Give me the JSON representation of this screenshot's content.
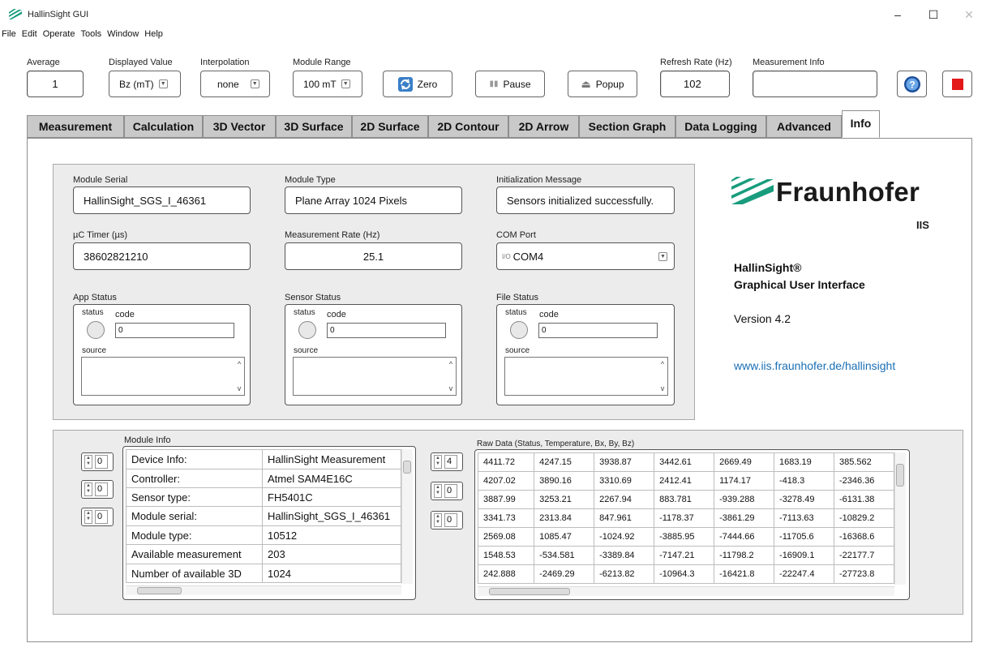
{
  "window": {
    "title": "HallinSight GUI",
    "controls": [
      "–",
      "☐",
      "✕"
    ]
  },
  "menu": [
    "File",
    "Edit",
    "Operate",
    "Tools",
    "Window",
    "Help"
  ],
  "toolbar": {
    "average": {
      "label": "Average",
      "value": "1"
    },
    "displayed_value": {
      "label": "Displayed Value",
      "value": "Bz (mT)"
    },
    "interpolation": {
      "label": "Interpolation",
      "value": "none"
    },
    "module_range": {
      "label": "Module Range",
      "value": "100 mT"
    },
    "zero_label": "Zero",
    "pause_label": "Pause",
    "popup_label": "Popup",
    "refresh_rate": {
      "label": "Refresh Rate (Hz)",
      "value": "102"
    },
    "measurement_info": {
      "label": "Measurement Info",
      "value": ""
    }
  },
  "tabs": [
    {
      "label": "Measurement"
    },
    {
      "label": "Calculation"
    },
    {
      "label": "3D Vector"
    },
    {
      "label": "3D Surface"
    },
    {
      "label": "2D Surface"
    },
    {
      "label": "2D Contour"
    },
    {
      "label": "2D Arrow"
    },
    {
      "label": "Section Graph"
    },
    {
      "label": "Data Logging"
    },
    {
      "label": "Advanced"
    },
    {
      "label": "Info"
    }
  ],
  "active_tab": "Info",
  "info": {
    "module_serial": {
      "label": "Module Serial",
      "value": "HallinSight_SGS_I_46361"
    },
    "module_type": {
      "label": "Module Type",
      "value": "Plane Array 1024 Pixels"
    },
    "init_message": {
      "label": "Initialization Message",
      "value": "Sensors initialized successfully."
    },
    "uc_timer": {
      "label": "µC Timer (µs)",
      "value": "38602821210"
    },
    "measurement_rate": {
      "label": "Measurement Rate (Hz)",
      "value": "25.1"
    },
    "com_port": {
      "label": "COM Port",
      "value": "COM4"
    },
    "app_status": {
      "label": "App Status",
      "status_label": "status",
      "code_label": "code",
      "code_value": "0",
      "source_label": "source"
    },
    "sensor_status": {
      "label": "Sensor Status",
      "status_label": "status",
      "code_label": "code",
      "code_value": "0",
      "source_label": "source"
    },
    "file_status": {
      "label": "File Status",
      "status_label": "status",
      "code_label": "code",
      "code_value": "0",
      "source_label": "source"
    }
  },
  "branding": {
    "logo_text": "Fraunhofer",
    "logo_sub": "IIS",
    "product_name": "HallinSight®",
    "product_desc": "Graphical User Interface",
    "version": "Version 4.2",
    "url": "www.iis.fraunhofer.de/hallinsight",
    "brand_color": "#179c7d",
    "link_color": "#1a6fb5"
  },
  "module_info": {
    "label": "Module Info",
    "spinners": [
      "0",
      "0",
      "0"
    ],
    "rows": [
      [
        "Device Info:",
        "HallinSight Measurement"
      ],
      [
        "Controller:",
        "Atmel SAM4E16C"
      ],
      [
        "Sensor type:",
        "FH5401C"
      ],
      [
        "Module serial:",
        "HallinSight_SGS_I_46361"
      ],
      [
        "Module type:",
        "10512"
      ],
      [
        "Available measurement",
        "203"
      ],
      [
        "Number of available 3D",
        "1024"
      ]
    ]
  },
  "raw_data": {
    "label": "Raw Data (Status, Temperature, Bx, By, Bz)",
    "spinners": [
      "4",
      "0",
      "0"
    ],
    "rows": [
      [
        "4411.72",
        "4247.15",
        "3938.87",
        "3442.61",
        "2669.49",
        "1683.19",
        "385.562"
      ],
      [
        "4207.02",
        "3890.16",
        "3310.69",
        "2412.41",
        "1174.17",
        "-418.3",
        "-2346.36"
      ],
      [
        "3887.99",
        "3253.21",
        "2267.94",
        "883.781",
        "-939.288",
        "-3278.49",
        "-6131.38"
      ],
      [
        "3341.73",
        "2313.84",
        "847.961",
        "-1178.37",
        "-3861.29",
        "-7113.63",
        "-10829.2"
      ],
      [
        "2569.08",
        "1085.47",
        "-1024.92",
        "-3885.95",
        "-7444.66",
        "-11705.6",
        "-16368.6"
      ],
      [
        "1548.53",
        "-534.581",
        "-3389.84",
        "-7147.21",
        "-11798.2",
        "-16909.1",
        "-22177.7"
      ],
      [
        "242.888",
        "-2469.29",
        "-6213.82",
        "-10964.3",
        "-16421.8",
        "-22247.4",
        "-27723.8"
      ]
    ]
  }
}
